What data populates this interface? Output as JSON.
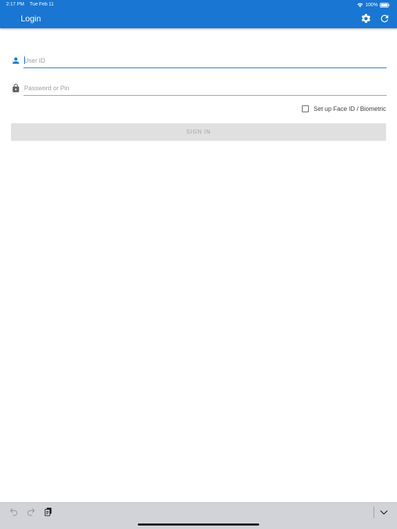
{
  "status_bar": {
    "time": "2:17 PM",
    "date": "Tue Feb 11",
    "battery": "100%"
  },
  "header": {
    "title": "Login",
    "settings_icon": "gear-icon",
    "refresh_icon": "refresh-icon",
    "background_color": "#1976d2"
  },
  "form": {
    "user_id": {
      "placeholder": "User ID",
      "value": "",
      "icon": "person-icon"
    },
    "password": {
      "placeholder": "Password or Pin",
      "value": "",
      "icon": "lock-icon"
    },
    "biometric": {
      "label": "Set up Face ID / Biometric",
      "checked": false
    },
    "sign_in_label": "SIGN IN"
  },
  "keyboard_bar": {
    "undo_icon": "undo-icon",
    "redo_icon": "redo-icon",
    "paste_icon": "paste-icon",
    "dismiss_icon": "chevron-down-icon"
  }
}
